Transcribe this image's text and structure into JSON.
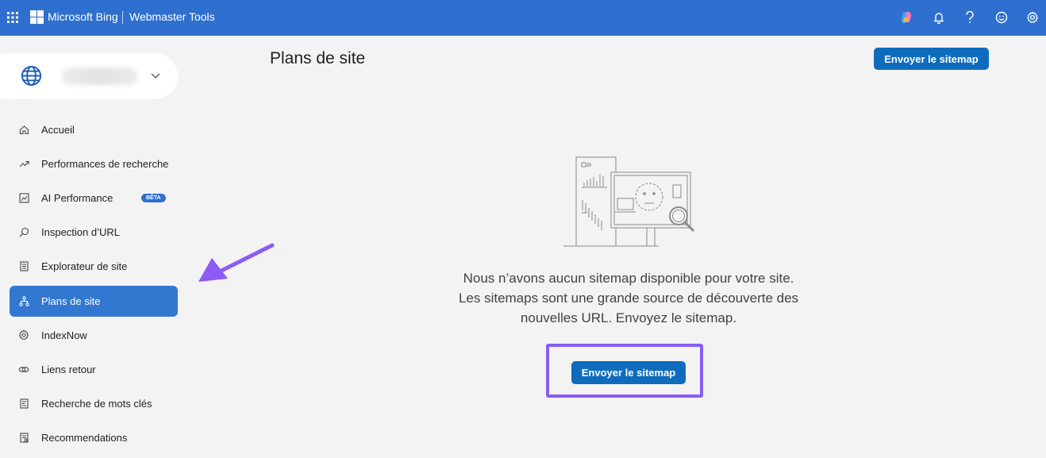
{
  "header": {
    "brand": "Microsoft Bing",
    "product": "Webmaster Tools",
    "icons": [
      "apps-grid-icon",
      "microsoft-logo-icon",
      "copilot-icon",
      "notifications-bell-icon",
      "help-icon",
      "feedback-smiley-icon",
      "settings-gear-icon"
    ]
  },
  "site_selector": {
    "icon": "globe-icon",
    "value_blurred": true
  },
  "sidebar": {
    "items": [
      {
        "label": "Accueil",
        "icon": "home-icon"
      },
      {
        "label": "Performances de recherche",
        "icon": "trend-up-icon"
      },
      {
        "label": "AI Performance",
        "icon": "ai-chart-icon",
        "badge": "BÊTA"
      },
      {
        "label": "Inspection d’URL",
        "icon": "search-icon"
      },
      {
        "label": "Explorateur de site",
        "icon": "document-list-icon"
      },
      {
        "label": "Plans de site",
        "icon": "sitemap-icon",
        "active": true
      },
      {
        "label": "IndexNow",
        "icon": "gear-cog-icon"
      },
      {
        "label": "Liens retour",
        "icon": "link-icon"
      },
      {
        "label": "Recherche de mots clés",
        "icon": "keyword-document-icon"
      },
      {
        "label": "Recommendations",
        "icon": "recommendations-icon"
      }
    ]
  },
  "main": {
    "title": "Plans de site",
    "submit_button_top": "Envoyer le sitemap",
    "empty_state": {
      "illustration": "empty-sitemap-illustration",
      "message": "Nous n’avons aucun sitemap disponible pour votre site. Les sitemaps sont une grande source de découverte des nouvelles URL. Envoyez le sitemap.",
      "button": "Envoyer le sitemap"
    }
  },
  "annotations": {
    "highlight_color": "#8b5cf6",
    "arrow_color": "#8b5cf6"
  },
  "colors": {
    "header_bg": "#2f6fcf",
    "active_nav_bg": "#3278d1",
    "primary_button": "#0f6cbd",
    "page_bg": "#f3f3f3"
  }
}
